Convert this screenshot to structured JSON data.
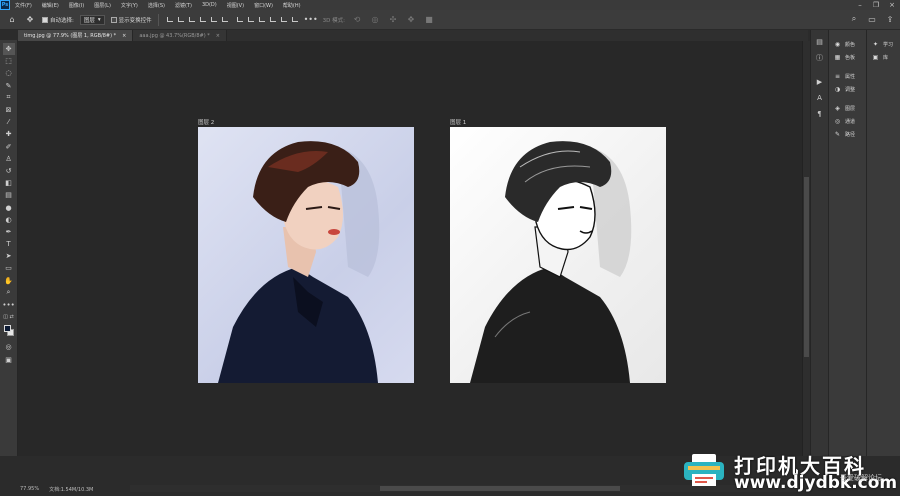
{
  "app": {
    "logo_text": "Ps"
  },
  "menu": [
    "文件(F)",
    "编辑(E)",
    "图像(I)",
    "图层(L)",
    "文字(Y)",
    "选择(S)",
    "滤镜(T)",
    "3D(D)",
    "视图(V)",
    "窗口(W)",
    "帮助(H)"
  ],
  "options": {
    "auto_select_label": "自动选择:",
    "auto_select_value": "图层",
    "show_transform_label": "显示变换控件",
    "mode_3d_label": "3D 模式:"
  },
  "tabs": [
    {
      "label": "timg.jpg @ 77.9% (图层 1, RGB/8#) *",
      "close": "×"
    },
    {
      "label": "aaa.jpg @ 43.7%(RGB/8#) *",
      "close": "×"
    }
  ],
  "canvas": {
    "left_layer_label": "图层 2",
    "right_layer_label": "图层 1"
  },
  "status": {
    "zoom": "77.95%",
    "doc_size": "文档:1.54M/10.3M"
  },
  "panels": {
    "group1": [
      "颜色",
      "色板"
    ],
    "group2": [
      "属性",
      "调整"
    ],
    "group3": [
      "图层",
      "通道",
      "路径"
    ],
    "learn": [
      "学习",
      "库"
    ]
  },
  "watermark": {
    "title": "打印机大百科",
    "url": "www.djydbk.com",
    "source": "吾爱破解论坛"
  },
  "colors": {
    "foreground": "#0c1a33",
    "background": "#e6e6e6",
    "ps_blue": "#31a8ff"
  }
}
